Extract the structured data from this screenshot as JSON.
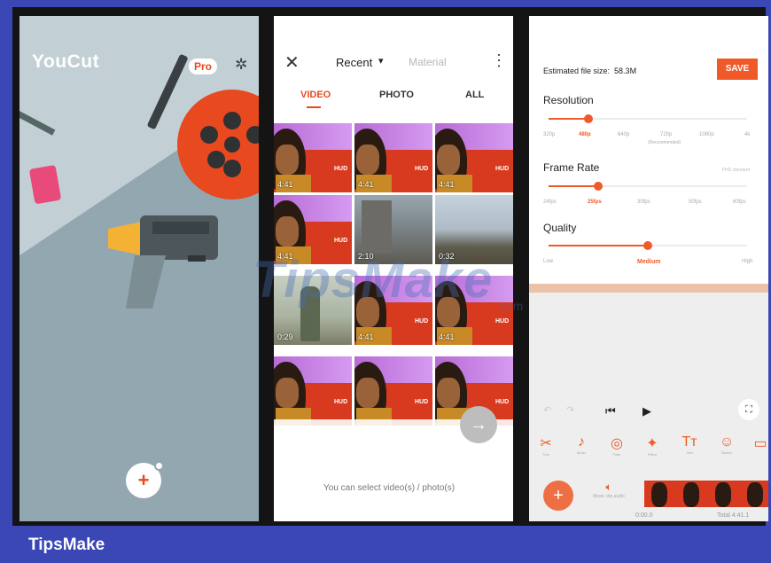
{
  "colors": {
    "frame": "#3a47b5",
    "accent": "#f05a28",
    "panel1_bg": "#93a7b1"
  },
  "home": {
    "logo": "YouCut",
    "pro_badge": "Pro",
    "settings_icon": "gear-icon",
    "add_icon": "+"
  },
  "picker": {
    "close_icon": "✕",
    "album": "Recent",
    "album_caret": "▾",
    "material": "Material",
    "more_icon": "⋮",
    "tabs": [
      "VIDEO",
      "PHOTO",
      "ALL"
    ],
    "active_tab": "VIDEO",
    "durations": [
      "4:41",
      "4:41",
      "4:41",
      "4:41",
      "2:10",
      "0:32",
      "0:29",
      "4:41",
      "4:41",
      "",
      "",
      ""
    ],
    "next_icon": "→",
    "hint": "You can select video(s) / photo(s)"
  },
  "export": {
    "estimated_label": "Estimated file size:",
    "estimated_value": "58.3M",
    "save": "SAVE",
    "resolution_label": "Resolution",
    "resolution_ticks": [
      "320p",
      "480p",
      "640p",
      "720p",
      "1080p",
      "4k"
    ],
    "resolution_recommended": "(Recommended)",
    "resolution_selected": "480p",
    "resolution_level": 0.2,
    "frame_rate_label": "Frame Rate",
    "frame_rate_note": "FHD standard",
    "frame_rate_ticks": [
      "24fps",
      "25fps",
      "30fps",
      "50fps",
      "60fps"
    ],
    "frame_rate_selected": "25fps",
    "frame_rate_level": 0.25,
    "quality_label": "Quality",
    "quality_ticks": [
      "Low",
      "Medium",
      "High"
    ],
    "quality_selected": "Medium",
    "quality_level": 0.5
  },
  "editor": {
    "undo_icon": "↶",
    "redo_icon": "↷",
    "prev_icon": "⏮",
    "play_icon": "▶",
    "expand_icon": "⛶",
    "tools": [
      {
        "icon": "✂",
        "label": "Trim"
      },
      {
        "icon": "♪",
        "label": "Music"
      },
      {
        "icon": "◎",
        "label": "Filter"
      },
      {
        "icon": "✦",
        "label": "Effect"
      },
      {
        "icon": "Tт",
        "label": "Text"
      },
      {
        "icon": "☺",
        "label": "Sticker"
      },
      {
        "icon": "▭",
        "label": ""
      }
    ],
    "add_icon": "+",
    "music_label": "Music clip audio",
    "time_current": "0:00.0",
    "time_total": "Total 4:41.1"
  },
  "watermark": {
    "main": "TipsMake",
    "small": ".com"
  },
  "footer": "TipsMake"
}
